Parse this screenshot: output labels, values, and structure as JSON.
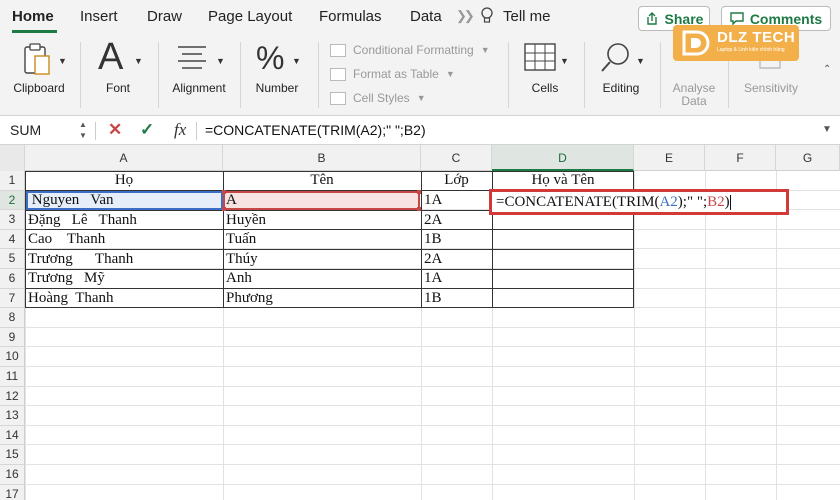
{
  "tabs": [
    "Home",
    "Insert",
    "Draw",
    "Page Layout",
    "Formulas",
    "Data"
  ],
  "tell_me": "Tell me",
  "share_label": "Share",
  "comments_label": "Comments",
  "ribbon": {
    "clipboard": "Clipboard",
    "font": "Font",
    "alignment": "Alignment",
    "number": "Number",
    "conditional_formatting": "Conditional Formatting",
    "format_as_table": "Format as Table",
    "cell_styles": "Cell Styles",
    "cells": "Cells",
    "editing": "Editing",
    "analyse_data_1": "Analyse",
    "analyse_data_2": "Data",
    "sensitivity": "Sensitivity"
  },
  "logo": {
    "text": "DLZ TECH",
    "sub": "Laptop & Linh kiện chính hãng"
  },
  "formula_bar": {
    "name_box": "SUM",
    "cancel": "✕",
    "confirm": "✓",
    "fx": "fx",
    "formula": "=CONCATENATE(TRIM(A2);\" \";B2)"
  },
  "columns": [
    "A",
    "B",
    "C",
    "D",
    "E",
    "F",
    "G"
  ],
  "rows": [
    "1",
    "2",
    "3",
    "4",
    "5",
    "6",
    "7",
    "8",
    "9",
    "10",
    "11",
    "12",
    "13",
    "14",
    "15",
    "16",
    "17"
  ],
  "sheet": {
    "headers": {
      "a": "Họ",
      "b": "Tên",
      "c": "Lớp",
      "d": "Họ và Tên"
    },
    "data": [
      {
        "a": " Nguyen   Van",
        "b": "A",
        "c": "1A"
      },
      {
        "a": "Đặng   Lê   Thanh",
        "b": "Huyền",
        "c": "2A"
      },
      {
        "a": "Cao    Thanh",
        "b": "Tuấn",
        "c": "1B"
      },
      {
        "a": "Trương      Thanh",
        "b": "Thúy",
        "c": "2A"
      },
      {
        "a": "Trương   Mỹ",
        "b": "Anh",
        "c": "1A"
      },
      {
        "a": "Hoàng  Thanh",
        "b": "Phương",
        "c": "1B"
      }
    ],
    "edit_formula": {
      "part1": "=CONCATENATE(TRIM(",
      "ref_a": "A2",
      "part2": ");\" \";",
      "ref_b": "B2",
      "part3": ")"
    }
  },
  "colors": {
    "accent": "#1e7a44",
    "ref_a": "#3b6fc6",
    "ref_b": "#c74747",
    "edit_border": "#d23a3a"
  }
}
